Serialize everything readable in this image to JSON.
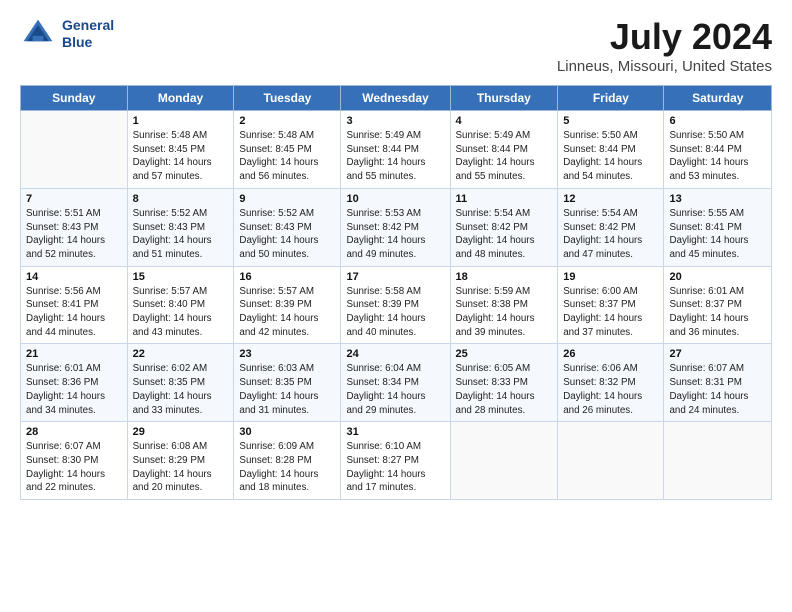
{
  "logo": {
    "line1": "General",
    "line2": "Blue"
  },
  "title": "July 2024",
  "subtitle": "Linneus, Missouri, United States",
  "days_of_week": [
    "Sunday",
    "Monday",
    "Tuesday",
    "Wednesday",
    "Thursday",
    "Friday",
    "Saturday"
  ],
  "weeks": [
    [
      {
        "day": "",
        "sunrise": "",
        "sunset": "",
        "daylight": ""
      },
      {
        "day": "1",
        "sunrise": "Sunrise: 5:48 AM",
        "sunset": "Sunset: 8:45 PM",
        "daylight": "Daylight: 14 hours and 57 minutes."
      },
      {
        "day": "2",
        "sunrise": "Sunrise: 5:48 AM",
        "sunset": "Sunset: 8:45 PM",
        "daylight": "Daylight: 14 hours and 56 minutes."
      },
      {
        "day": "3",
        "sunrise": "Sunrise: 5:49 AM",
        "sunset": "Sunset: 8:44 PM",
        "daylight": "Daylight: 14 hours and 55 minutes."
      },
      {
        "day": "4",
        "sunrise": "Sunrise: 5:49 AM",
        "sunset": "Sunset: 8:44 PM",
        "daylight": "Daylight: 14 hours and 55 minutes."
      },
      {
        "day": "5",
        "sunrise": "Sunrise: 5:50 AM",
        "sunset": "Sunset: 8:44 PM",
        "daylight": "Daylight: 14 hours and 54 minutes."
      },
      {
        "day": "6",
        "sunrise": "Sunrise: 5:50 AM",
        "sunset": "Sunset: 8:44 PM",
        "daylight": "Daylight: 14 hours and 53 minutes."
      }
    ],
    [
      {
        "day": "7",
        "sunrise": "Sunrise: 5:51 AM",
        "sunset": "Sunset: 8:43 PM",
        "daylight": "Daylight: 14 hours and 52 minutes."
      },
      {
        "day": "8",
        "sunrise": "Sunrise: 5:52 AM",
        "sunset": "Sunset: 8:43 PM",
        "daylight": "Daylight: 14 hours and 51 minutes."
      },
      {
        "day": "9",
        "sunrise": "Sunrise: 5:52 AM",
        "sunset": "Sunset: 8:43 PM",
        "daylight": "Daylight: 14 hours and 50 minutes."
      },
      {
        "day": "10",
        "sunrise": "Sunrise: 5:53 AM",
        "sunset": "Sunset: 8:42 PM",
        "daylight": "Daylight: 14 hours and 49 minutes."
      },
      {
        "day": "11",
        "sunrise": "Sunrise: 5:54 AM",
        "sunset": "Sunset: 8:42 PM",
        "daylight": "Daylight: 14 hours and 48 minutes."
      },
      {
        "day": "12",
        "sunrise": "Sunrise: 5:54 AM",
        "sunset": "Sunset: 8:42 PM",
        "daylight": "Daylight: 14 hours and 47 minutes."
      },
      {
        "day": "13",
        "sunrise": "Sunrise: 5:55 AM",
        "sunset": "Sunset: 8:41 PM",
        "daylight": "Daylight: 14 hours and 45 minutes."
      }
    ],
    [
      {
        "day": "14",
        "sunrise": "Sunrise: 5:56 AM",
        "sunset": "Sunset: 8:41 PM",
        "daylight": "Daylight: 14 hours and 44 minutes."
      },
      {
        "day": "15",
        "sunrise": "Sunrise: 5:57 AM",
        "sunset": "Sunset: 8:40 PM",
        "daylight": "Daylight: 14 hours and 43 minutes."
      },
      {
        "day": "16",
        "sunrise": "Sunrise: 5:57 AM",
        "sunset": "Sunset: 8:39 PM",
        "daylight": "Daylight: 14 hours and 42 minutes."
      },
      {
        "day": "17",
        "sunrise": "Sunrise: 5:58 AM",
        "sunset": "Sunset: 8:39 PM",
        "daylight": "Daylight: 14 hours and 40 minutes."
      },
      {
        "day": "18",
        "sunrise": "Sunrise: 5:59 AM",
        "sunset": "Sunset: 8:38 PM",
        "daylight": "Daylight: 14 hours and 39 minutes."
      },
      {
        "day": "19",
        "sunrise": "Sunrise: 6:00 AM",
        "sunset": "Sunset: 8:37 PM",
        "daylight": "Daylight: 14 hours and 37 minutes."
      },
      {
        "day": "20",
        "sunrise": "Sunrise: 6:01 AM",
        "sunset": "Sunset: 8:37 PM",
        "daylight": "Daylight: 14 hours and 36 minutes."
      }
    ],
    [
      {
        "day": "21",
        "sunrise": "Sunrise: 6:01 AM",
        "sunset": "Sunset: 8:36 PM",
        "daylight": "Daylight: 14 hours and 34 minutes."
      },
      {
        "day": "22",
        "sunrise": "Sunrise: 6:02 AM",
        "sunset": "Sunset: 8:35 PM",
        "daylight": "Daylight: 14 hours and 33 minutes."
      },
      {
        "day": "23",
        "sunrise": "Sunrise: 6:03 AM",
        "sunset": "Sunset: 8:35 PM",
        "daylight": "Daylight: 14 hours and 31 minutes."
      },
      {
        "day": "24",
        "sunrise": "Sunrise: 6:04 AM",
        "sunset": "Sunset: 8:34 PM",
        "daylight": "Daylight: 14 hours and 29 minutes."
      },
      {
        "day": "25",
        "sunrise": "Sunrise: 6:05 AM",
        "sunset": "Sunset: 8:33 PM",
        "daylight": "Daylight: 14 hours and 28 minutes."
      },
      {
        "day": "26",
        "sunrise": "Sunrise: 6:06 AM",
        "sunset": "Sunset: 8:32 PM",
        "daylight": "Daylight: 14 hours and 26 minutes."
      },
      {
        "day": "27",
        "sunrise": "Sunrise: 6:07 AM",
        "sunset": "Sunset: 8:31 PM",
        "daylight": "Daylight: 14 hours and 24 minutes."
      }
    ],
    [
      {
        "day": "28",
        "sunrise": "Sunrise: 6:07 AM",
        "sunset": "Sunset: 8:30 PM",
        "daylight": "Daylight: 14 hours and 22 minutes."
      },
      {
        "day": "29",
        "sunrise": "Sunrise: 6:08 AM",
        "sunset": "Sunset: 8:29 PM",
        "daylight": "Daylight: 14 hours and 20 minutes."
      },
      {
        "day": "30",
        "sunrise": "Sunrise: 6:09 AM",
        "sunset": "Sunset: 8:28 PM",
        "daylight": "Daylight: 14 hours and 18 minutes."
      },
      {
        "day": "31",
        "sunrise": "Sunrise: 6:10 AM",
        "sunset": "Sunset: 8:27 PM",
        "daylight": "Daylight: 14 hours and 17 minutes."
      },
      {
        "day": "",
        "sunrise": "",
        "sunset": "",
        "daylight": ""
      },
      {
        "day": "",
        "sunrise": "",
        "sunset": "",
        "daylight": ""
      },
      {
        "day": "",
        "sunrise": "",
        "sunset": "",
        "daylight": ""
      }
    ]
  ]
}
